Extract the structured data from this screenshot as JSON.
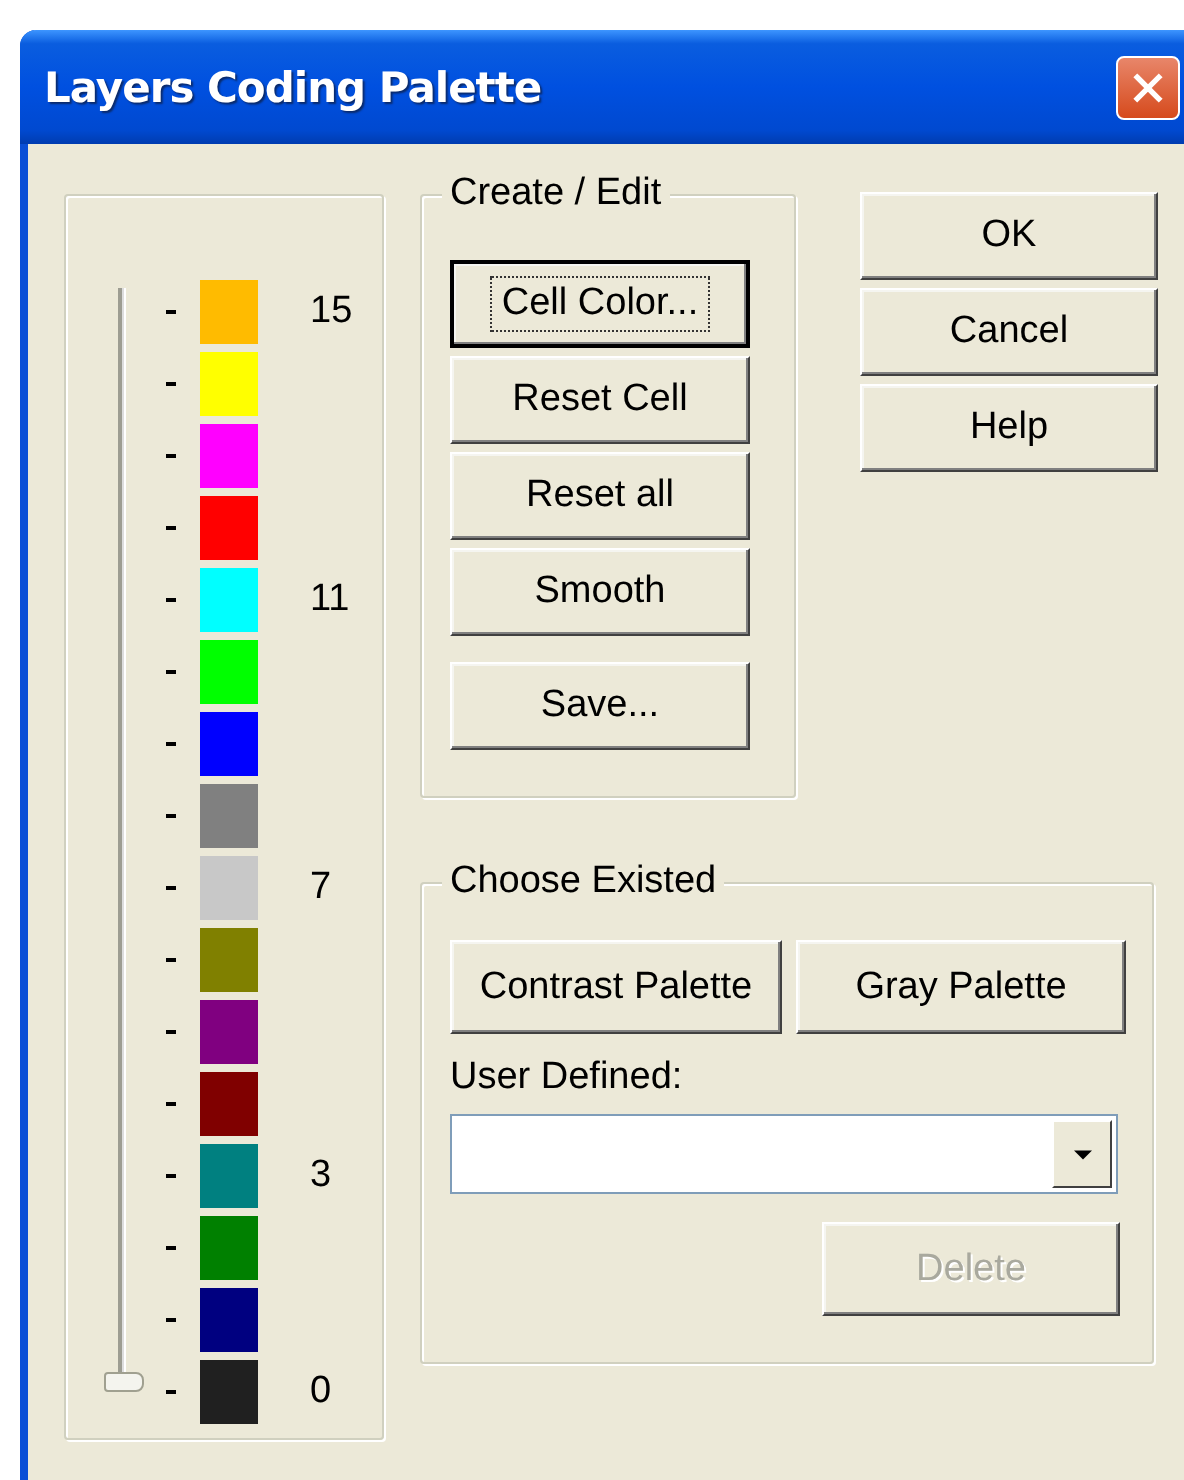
{
  "window": {
    "title": "Layers Coding Palette"
  },
  "palette": {
    "slider": {
      "level": 0
    },
    "swatches": [
      {
        "color": "#ffbb00",
        "label": "15"
      },
      {
        "color": "#ffff00"
      },
      {
        "color": "#ff00ff"
      },
      {
        "color": "#ff0000"
      },
      {
        "color": "#00ffff",
        "label": "11"
      },
      {
        "color": "#00ff00"
      },
      {
        "color": "#0000ff"
      },
      {
        "color": "#808080"
      },
      {
        "color": "#c8c8c8",
        "label": "7"
      },
      {
        "color": "#808000"
      },
      {
        "color": "#800080"
      },
      {
        "color": "#800000"
      },
      {
        "color": "#008080",
        "label": "3"
      },
      {
        "color": "#008000"
      },
      {
        "color": "#000080"
      },
      {
        "color": "#202020",
        "label": "0"
      }
    ]
  },
  "create_edit": {
    "title": "Create / Edit",
    "buttons": [
      {
        "label": "Cell Color...",
        "default": true
      },
      {
        "label": "Reset Cell",
        "default": false
      },
      {
        "label": "Reset all",
        "default": false
      },
      {
        "label": "Smooth",
        "default": false
      },
      {
        "label": "Save...",
        "default": false
      }
    ]
  },
  "dialog_buttons": [
    {
      "label": "OK"
    },
    {
      "label": "Cancel"
    },
    {
      "label": "Help"
    }
  ],
  "choose_existed": {
    "title": "Choose Existed",
    "buttons": [
      {
        "label": "Contrast Palette"
      },
      {
        "label": "Gray Palette"
      }
    ],
    "user_defined": {
      "label": "User Defined:"
    },
    "delete": {
      "label": "Delete",
      "disabled": true
    }
  }
}
